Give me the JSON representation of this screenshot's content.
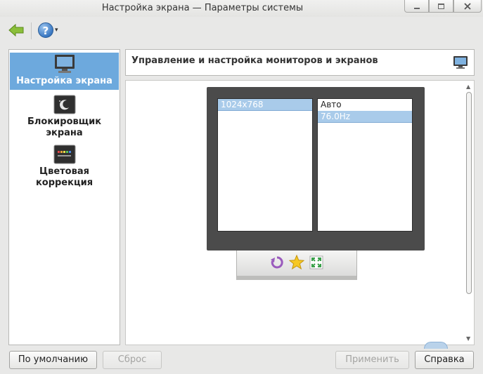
{
  "window": {
    "title": "Настройка экрана — Параметры системы"
  },
  "toolbar": {
    "back_icon": "back-arrow-icon",
    "help_icon": "help-icon",
    "help_glyph": "?",
    "help_dropdown_glyph": "▾"
  },
  "sidebar": {
    "items": [
      {
        "label": "Настройка экрана",
        "icon": "display-icon",
        "active": true
      },
      {
        "label": "Блокировщик экрана",
        "icon": "screen-locker-icon",
        "active": false
      },
      {
        "label": "Цветовая коррекция",
        "icon": "color-correction-icon",
        "active": false
      }
    ]
  },
  "header": {
    "text": "Управление и настройка мониторов и экранов",
    "icon": "monitor-icon"
  },
  "display": {
    "resolutions": [
      {
        "label": "1024x768",
        "selected": true
      }
    ],
    "refresh_rates": [
      {
        "label": "Авто",
        "selected": false
      },
      {
        "label": "76.0Hz",
        "selected": true
      }
    ],
    "stand_actions": [
      {
        "icon": "rotate-icon"
      },
      {
        "icon": "primary-star-icon"
      },
      {
        "icon": "fit-screen-icon"
      }
    ]
  },
  "buttons": {
    "defaults": "По умолчанию",
    "reset": "Сброс",
    "apply": "Применить",
    "help": "Справка"
  },
  "colors": {
    "selection": "#6da9dd",
    "list_selection": "#a9cbea",
    "monitor_frame": "#4b4b4b",
    "disabled_text": "#a4a4a2"
  }
}
